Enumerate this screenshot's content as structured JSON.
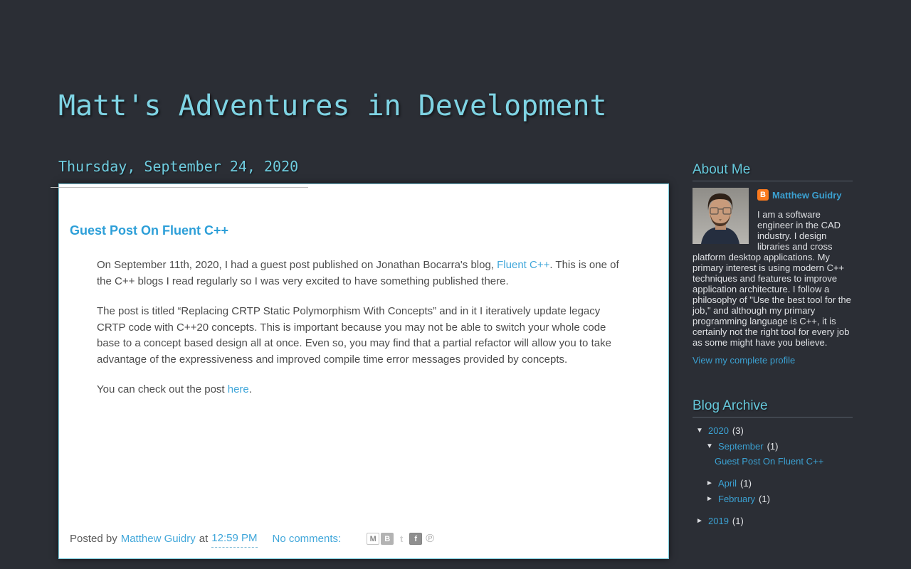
{
  "header": {
    "title": "Matt's Adventures in Development"
  },
  "post": {
    "date_header": "Thursday, September 24, 2020",
    "title": "Guest Post On Fluent C++",
    "p1_before": "On September 11th, 2020, I had a guest post published on Jonathan Bocarra's blog, ",
    "p1_link": "Fluent C++",
    "p1_after": ". This is one of the C++ blogs I read regularly so I was very excited to have something published there.",
    "p2": "The post is titled “Replacing CRTP Static Polymorphism With Concepts” and in it I iteratively update legacy CRTP code with C++20 concepts. This is important because you may not be able to switch your whole code base to a concept based design all at once. Even so, you may find that a partial refactor will allow you to take advantage of the expressiveness and improved compile time error messages provided by concepts.",
    "p3_before": "You can check out the post ",
    "p3_link": "here",
    "p3_after": ".",
    "footer": {
      "posted_by": "Posted by",
      "author": "Matthew Guidry",
      "at": "at",
      "time": "12:59 PM",
      "comments": "No comments:"
    }
  },
  "sidebar": {
    "about": {
      "title": "About Me",
      "name": "Matthew Guidry",
      "bio": "I am a software engineer in the CAD industry. I design libraries and cross platform desktop applications. My primary interest is using modern C++ techniques and features to improve application architecture. I follow a philosophy of \"Use the best tool for the job,\" and although my primary programming language is C++, it is certainly not the right tool for every job as some might have you believe.",
      "profile_link": "View my complete profile"
    },
    "archive": {
      "title": "Blog Archive",
      "rows": [
        {
          "toggle": "▼",
          "label": "2020",
          "count": "(3)"
        },
        {
          "toggle": "▼",
          "label": "September",
          "count": "(1)"
        },
        {
          "toggle": "►",
          "label": "April",
          "count": "(1)"
        },
        {
          "toggle": "►",
          "label": "February",
          "count": "(1)"
        },
        {
          "toggle": "►",
          "label": "2019",
          "count": "(1)"
        }
      ],
      "post_link": "Guest Post On Fluent C++"
    }
  },
  "icons": {
    "blogger": "B",
    "email": "M",
    "blogthis": "B",
    "twitter": "t",
    "facebook": "f",
    "pinterest": "℗"
  },
  "colors": {
    "page_bg": "#2b2e35",
    "title_cyan": "#7fd4e4",
    "heading_cyan": "#66c8db",
    "link_blue": "#3ba1d2",
    "post_title_blue": "#2d9fd8",
    "body_text": "#4c4c4c",
    "blogger_orange": "#fb7a1e",
    "content_bg": "#ffffff",
    "content_border": "#79cbdc"
  }
}
